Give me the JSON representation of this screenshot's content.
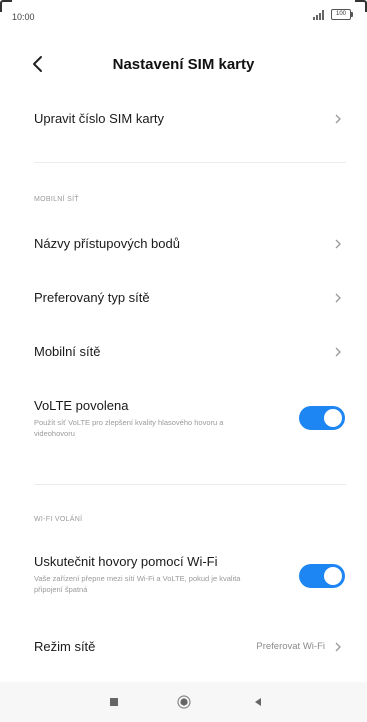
{
  "status_bar": {
    "time": "10:00",
    "battery": "100",
    "signal_icon": "signal-icon"
  },
  "header": {
    "title": "Nastavení SIM karty",
    "back_icon": "back-arrow-icon"
  },
  "rows": {
    "edit_number": {
      "label": "Upravit číslo SIM karty"
    },
    "apn": {
      "label": "Názvy přístupových bodů"
    },
    "network_type": {
      "label": "Preferovaný typ sítě"
    },
    "mobile_networks": {
      "label": "Mobilní sítě"
    },
    "volte": {
      "label": "VoLTE povolena",
      "subtext": "Použít síť VoLTE pro zlepšení kvality hlasového hovoru a videohovoru",
      "enabled": true
    },
    "wifi_calling": {
      "label": "Uskutečnit hovory pomocí Wi-Fi",
      "subtext": "Vaše zařízení přepne mezi sítí Wi-Fi a VoLTE, pokud je kvalita připojení špatná",
      "enabled": true
    },
    "network_mode": {
      "label": "Režim sítě",
      "value": "Preferovat Wi-Fi"
    }
  },
  "sections": {
    "mobile_network": "MOBILNÍ SÍŤ",
    "wifi_calling": "WI-FI VOLÁNÍ"
  },
  "colors": {
    "accent": "#1d86f2",
    "background": "#ffffff",
    "secondary_text": "#9a9a9a"
  },
  "navbar": {
    "recents_icon": "square-icon",
    "home_icon": "circle-home-icon",
    "back_icon": "triangle-back-icon"
  }
}
